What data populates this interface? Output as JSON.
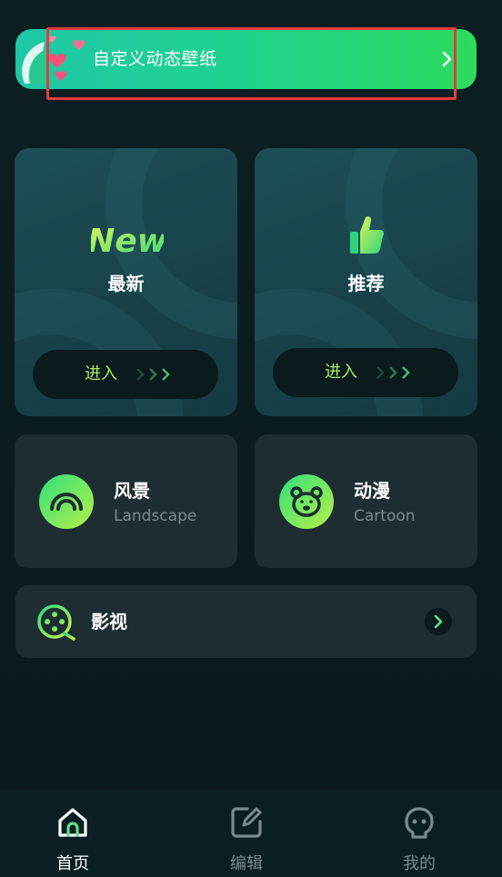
{
  "banner": {
    "title": "自定义动态壁纸",
    "arrow_icon": "chevron-right-icon"
  },
  "cards": {
    "latest": {
      "badge": "New",
      "label": "最新",
      "enter_label": "进入"
    },
    "recommended": {
      "icon": "thumbs-up-icon",
      "label": "推荐",
      "enter_label": "进入"
    }
  },
  "categories": [
    {
      "title": "风景",
      "subtitle": "Landscape",
      "icon": "rainbow-icon"
    },
    {
      "title": "动漫",
      "subtitle": "Cartoon",
      "icon": "bear-face-icon"
    }
  ],
  "film": {
    "label": "影视",
    "icon": "film-reel-icon"
  },
  "tabs": [
    {
      "label": "首页",
      "icon": "home-icon",
      "active": true
    },
    {
      "label": "编辑",
      "icon": "edit-icon",
      "active": false
    },
    {
      "label": "我的",
      "icon": "profile-icon",
      "active": false
    }
  ],
  "colors": {
    "accent": "#a6f064",
    "banner_start": "#1fc7a6",
    "banner_end": "#2ddb5c",
    "highlight": "#e33b3f"
  }
}
